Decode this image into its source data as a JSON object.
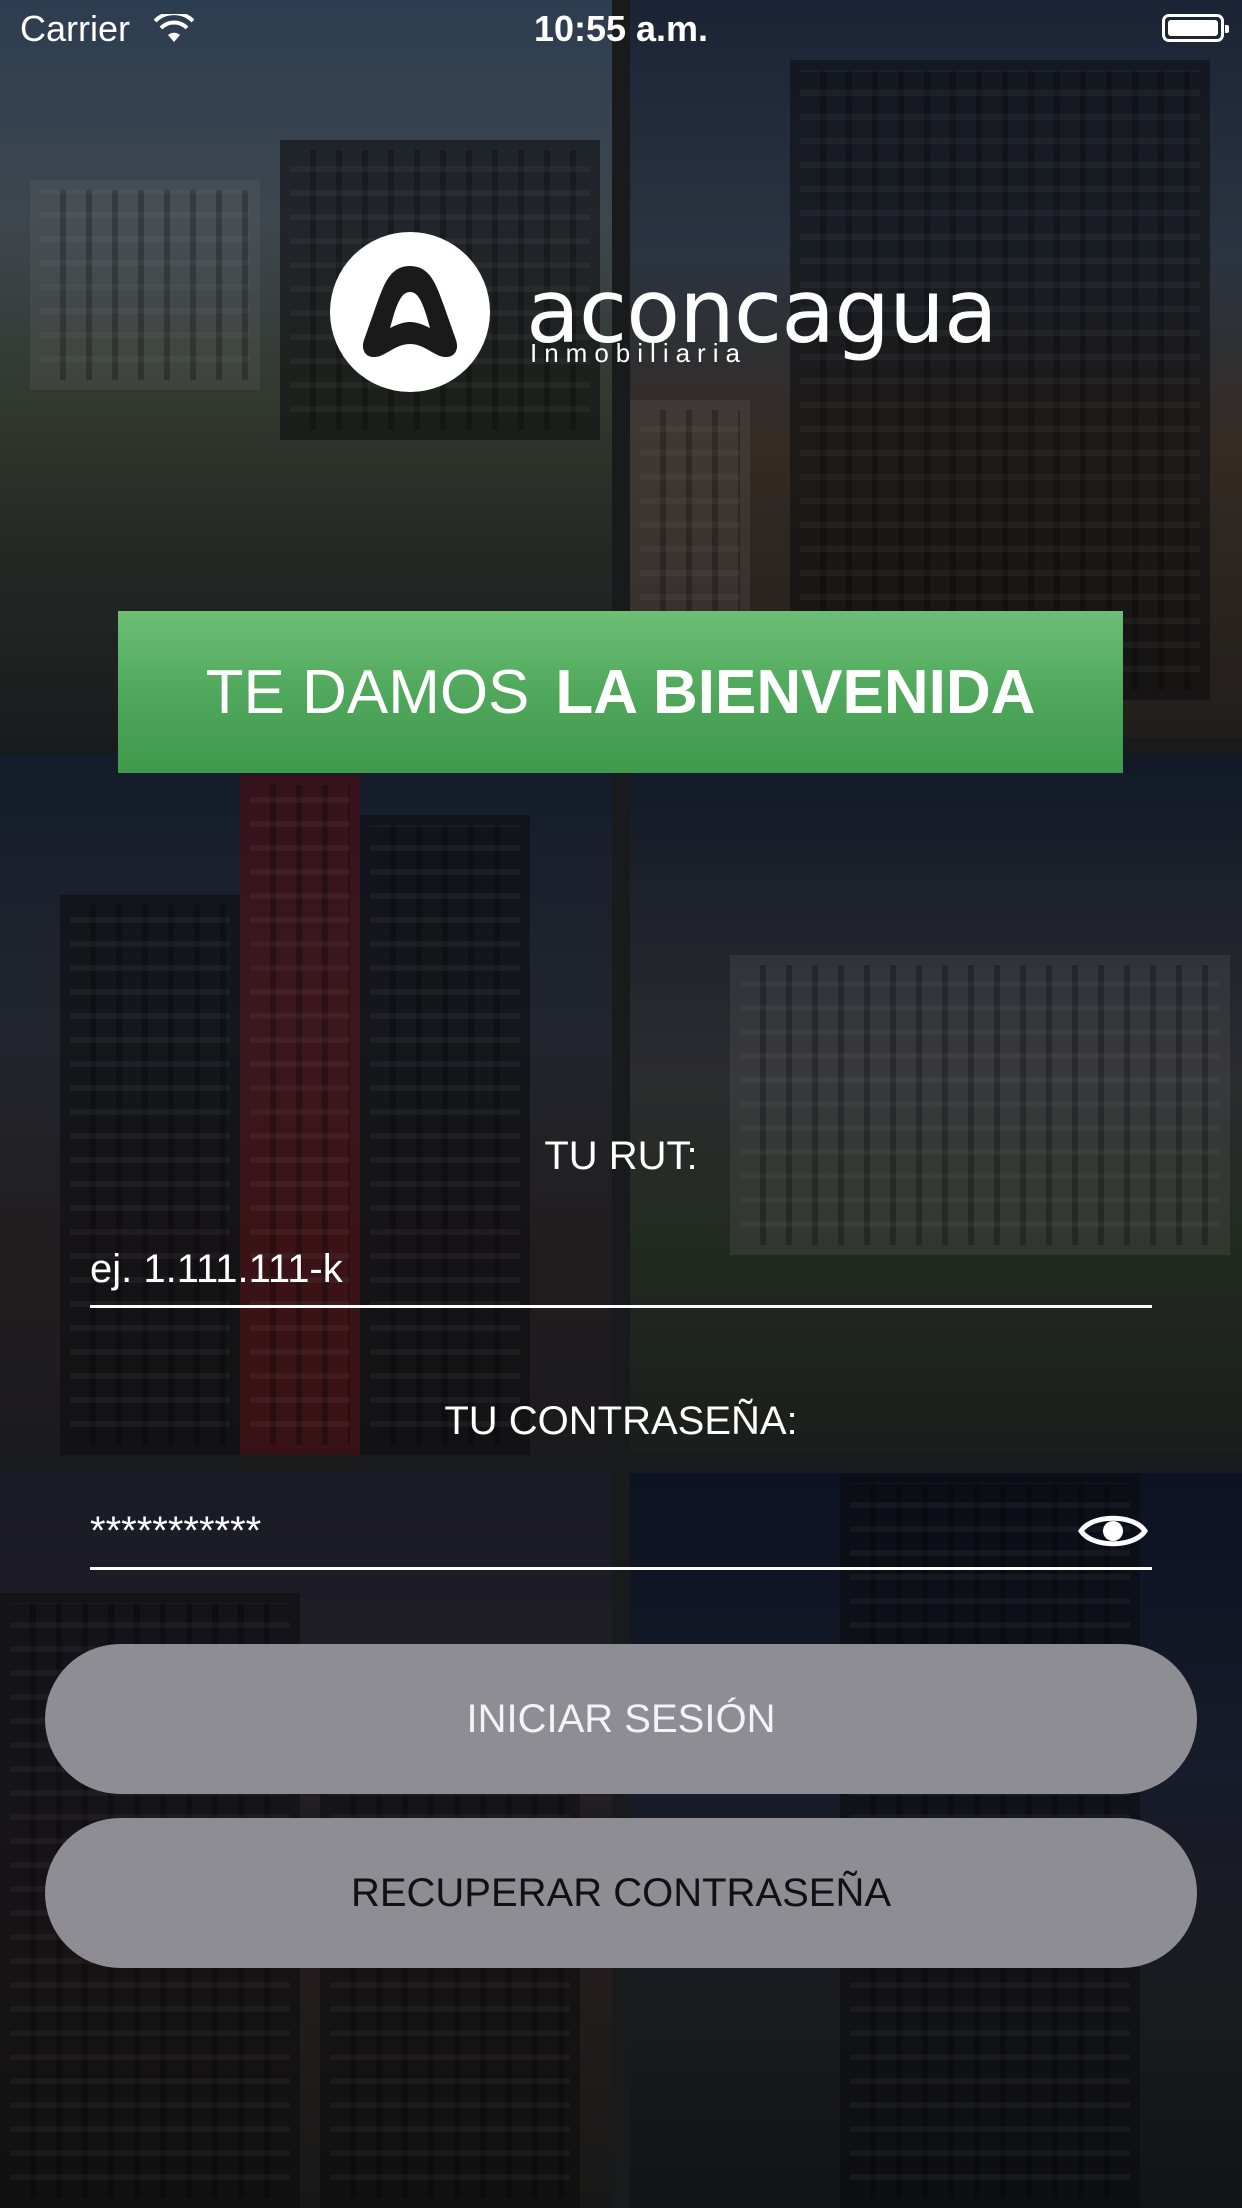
{
  "status_bar": {
    "carrier": "Carrier",
    "time": "10:55 a.m."
  },
  "logo": {
    "name": "aconcagua",
    "subtitle": "Inmobiliaria"
  },
  "welcome": {
    "light_text": "TE DAMOS",
    "bold_text": "LA BIENVENIDA",
    "color": "#4ea65a"
  },
  "form": {
    "rut_label": "TU RUT:",
    "rut_placeholder": "ej. 1.111.111-k",
    "rut_value": "",
    "password_label": "TU CONTRASEÑA:",
    "password_value": "***********"
  },
  "buttons": {
    "login_label": "INICIAR SESIÓN",
    "recover_label": "RECUPERAR CONTRASEÑA",
    "color": "#8d8d93"
  },
  "icons": {
    "wifi": "wifi-icon",
    "battery": "battery-icon",
    "show_password": "eye-icon"
  }
}
